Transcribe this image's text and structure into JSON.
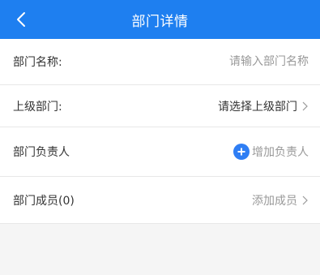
{
  "header": {
    "title": "部门详情",
    "back_icon": "chevron-left-icon"
  },
  "colors": {
    "header_bg": "#1e7ff0",
    "accent": "#2f7ef4"
  },
  "form": {
    "dept_name": {
      "label": "部门名称:",
      "value": "",
      "placeholder": "请输入部门名称"
    },
    "parent_dept": {
      "label": "上级部门:",
      "value": "请选择上级部门",
      "icon": "chevron-right-icon"
    },
    "dept_head": {
      "label": "部门负责人",
      "action": "增加负责人",
      "icon": "plus-circle-icon"
    },
    "dept_members": {
      "label": "部门成员(0)",
      "action": "添加成员",
      "icon": "chevron-right-icon"
    }
  }
}
